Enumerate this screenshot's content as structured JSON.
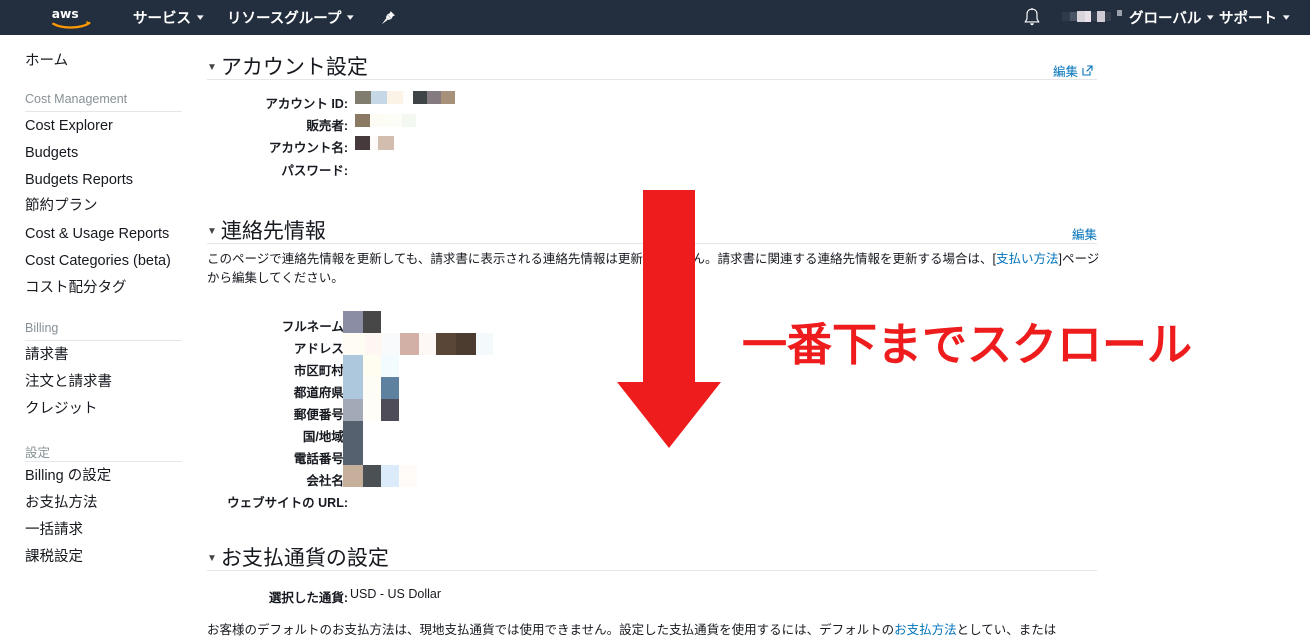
{
  "topnav": {
    "logo_alt": "aws",
    "services_label": "サービス",
    "resource_groups_label": "リソースグループ",
    "pin_icon": "pin-icon",
    "bell_icon": "bell-icon",
    "account_menu_label": "",
    "region_label": "グローバル",
    "support_label": "サポート",
    "caret": "▾",
    "bg_color": "#232f3e"
  },
  "sidebar": {
    "home_label": "ホーム",
    "groups": [
      {
        "title": "Cost Management",
        "items": [
          {
            "label": "Cost Explorer"
          },
          {
            "label": "Budgets"
          },
          {
            "label": "Budgets Reports"
          },
          {
            "label": "節約プラン"
          },
          {
            "label": "Cost & Usage Reports"
          },
          {
            "label": "Cost Categories (beta)"
          },
          {
            "label": "コスト配分タグ"
          }
        ]
      },
      {
        "title": "Billing",
        "items": [
          {
            "label": "請求書"
          },
          {
            "label": "注文と請求書"
          },
          {
            "label": "クレジット"
          }
        ]
      },
      {
        "title": "設定",
        "items": [
          {
            "label": "Billing の設定"
          },
          {
            "label": "お支払方法"
          },
          {
            "label": "一括請求"
          },
          {
            "label": "課税設定"
          }
        ]
      }
    ]
  },
  "account_settings": {
    "title": "アカウント設定",
    "edit_label": "編集",
    "fields": [
      {
        "label": "アカウント ID:",
        "value": ""
      },
      {
        "label": "販売者:",
        "value": ""
      },
      {
        "label": "アカウント名:",
        "value": ""
      },
      {
        "label": "パスワード:",
        "value": ""
      }
    ]
  },
  "contact_information": {
    "title": "連絡先情報",
    "edit_label": "編集",
    "description_part1": "このページで連絡先情報を更新しても、請求書に表示される連絡先情報は更新されません。請求書に関連する連絡先情報を更新する場合は、[",
    "description_link": "支払い方法",
    "description_part2": "]ページから編集してください。",
    "fields": [
      {
        "label": "フルネーム:",
        "value": ""
      },
      {
        "label": "アドレス:",
        "value": ""
      },
      {
        "label": "市区町村:",
        "value": ""
      },
      {
        "label": "都道府県:",
        "value": ""
      },
      {
        "label": "郵便番号:",
        "value": ""
      },
      {
        "label": "国/地域:",
        "value": ""
      },
      {
        "label": "電話番号:",
        "value": ""
      },
      {
        "label": "会社名:",
        "value": ""
      },
      {
        "label": "ウェブサイトの URL:",
        "value": ""
      }
    ]
  },
  "payment_currency": {
    "title": "お支払通貨の設定",
    "selected_label": "選択した通貨:",
    "selected_value": "USD - US Dollar",
    "note_part1": "お客様のデフォルトのお支払方法は、現地支払通貨では使用できません。設定した支払通貨を使用するには、デフォルトの",
    "note_link": "お支払方法",
    "note_part2": "としてい、または"
  },
  "annotation": {
    "text": "一番下までスクロール",
    "color": "#ee1c1c",
    "arrow_direction": "down"
  }
}
